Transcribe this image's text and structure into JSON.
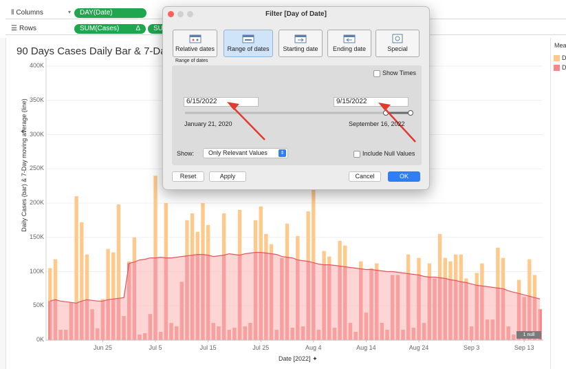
{
  "shelves": {
    "columns_label": "Columns",
    "columns_pill": "DAY(Date)",
    "rows_label": "Rows",
    "rows_pill_1": "SUM(Cases)",
    "rows_pill_1_delta": "Δ",
    "rows_pill_2": "SUM("
  },
  "sheet": {
    "title": "90 Days Cases Daily Bar & 7-Day A",
    "y_axis_title": "Daily Cases (bar) & 7-Day moving average (line)",
    "x_axis_title": "Date [2022]",
    "null_badge": "1 null"
  },
  "legend": {
    "title": "Meas",
    "items": [
      {
        "label": "Di",
        "color": "#ffc98b"
      },
      {
        "label": "Di",
        "color": "#f4878a"
      }
    ]
  },
  "dialog": {
    "title": "Filter [Day of Date]",
    "tabs": [
      {
        "label": "Relative dates",
        "active": false
      },
      {
        "label": "Range of dates",
        "active": true
      },
      {
        "label": "Starting date",
        "active": false
      },
      {
        "label": "Ending date",
        "active": false
      },
      {
        "label": "Special",
        "active": false
      }
    ],
    "section_label": "Range of dates",
    "show_times_label": "Show Times",
    "start_value": "6/15/2022",
    "end_value": "9/15/2022",
    "range_min_label": "January 21, 2020",
    "range_max_label": "September 16, 2022",
    "show_label": "Show:",
    "show_selected": "Only Relevant Values",
    "include_null_label": "Include Null Values",
    "buttons": {
      "reset": "Reset",
      "apply": "Apply",
      "cancel": "Cancel",
      "ok": "OK"
    }
  },
  "colors": {
    "bar": "#ffc98b",
    "bar_highlight": "#f4878a",
    "area": "#fbb3b3",
    "line": "#e4545a",
    "arrow": "#e03b2e",
    "accent": "#2f7ef6",
    "pill": "#1fa64f"
  },
  "chart_data": {
    "type": "bar",
    "title": "90 Days Cases Daily Bar & 7-Day A",
    "xlabel": "Date [2022]",
    "ylabel": "Daily Cases (bar) & 7-Day moving average (line)",
    "ylim": [
      0,
      400000
    ],
    "yticks": [
      {
        "label": "0K",
        "value": 0
      },
      {
        "label": "50K",
        "value": 50000
      },
      {
        "label": "100K",
        "value": 100000
      },
      {
        "label": "150K",
        "value": 150000
      },
      {
        "label": "200K",
        "value": 200000
      },
      {
        "label": "250K",
        "value": 250000
      },
      {
        "label": "300K",
        "value": 300000
      },
      {
        "label": "350K",
        "value": 350000
      },
      {
        "label": "400K",
        "value": 400000
      }
    ],
    "xticks": [
      {
        "label": "Jun 25",
        "index": 10
      },
      {
        "label": "Jul 5",
        "index": 20
      },
      {
        "label": "Jul 15",
        "index": 30
      },
      {
        "label": "Jul 25",
        "index": 40
      },
      {
        "label": "Aug 4",
        "index": 50
      },
      {
        "label": "Aug 14",
        "index": 60
      },
      {
        "label": "Aug 24",
        "index": 70
      },
      {
        "label": "Sep 3",
        "index": 80
      },
      {
        "label": "Sep 13",
        "index": 90
      }
    ],
    "start_date": "Jun 15",
    "series": [
      {
        "name": "Daily Cases",
        "type": "bar",
        "values": [
          105000,
          118000,
          15000,
          15000,
          55000,
          210000,
          172000,
          125000,
          45000,
          17000,
          60000,
          133000,
          128000,
          198000,
          35000,
          115000,
          150000,
          8000,
          10000,
          38000,
          240000,
          12000,
          200000,
          25000,
          20000,
          85000,
          175000,
          185000,
          158000,
          200000,
          168000,
          25000,
          20000,
          185000,
          15000,
          18000,
          190000,
          20000,
          25000,
          175000,
          195000,
          155000,
          140000,
          15000,
          120000,
          170000,
          18000,
          152000,
          20000,
          188000,
          220000,
          15000,
          130000,
          122000,
          18000,
          145000,
          138000,
          25000,
          12000,
          115000,
          40000,
          105000,
          112000,
          25000,
          15000,
          95000,
          95000,
          15000,
          125000,
          18000,
          120000,
          25000,
          112000,
          90000,
          155000,
          120000,
          115000,
          125000,
          125000,
          90000,
          20000,
          98000,
          112000,
          30000,
          30000,
          135000,
          120000,
          20000,
          8000,
          88000,
          63000,
          118000,
          95000,
          45000
        ]
      },
      {
        "name": "7-Day moving average",
        "type": "area",
        "values": [
          57000,
          59000,
          57000,
          56000,
          55000,
          54000,
          57000,
          59000,
          58000,
          57000,
          57000,
          59000,
          60000,
          61000,
          62000,
          112000,
          114000,
          117000,
          118000,
          120000,
          120000,
          121000,
          120000,
          120000,
          121000,
          122000,
          123000,
          124000,
          125000,
          125000,
          124000,
          122000,
          123000,
          124000,
          126000,
          125000,
          124000,
          126000,
          127000,
          128000,
          128000,
          127000,
          126000,
          125000,
          122000,
          121000,
          120000,
          117000,
          116000,
          115000,
          113000,
          111000,
          110000,
          110000,
          109000,
          108000,
          107000,
          106000,
          105000,
          104000,
          103000,
          103000,
          102000,
          101000,
          100000,
          100000,
          99000,
          98000,
          97000,
          96000,
          95000,
          93000,
          92000,
          92000,
          91000,
          90000,
          88000,
          87000,
          85000,
          84000,
          82000,
          80000,
          79000,
          78000,
          77000,
          76000,
          75000,
          72000,
          70000,
          68000,
          66000,
          64000,
          62000,
          60000
        ]
      }
    ]
  }
}
